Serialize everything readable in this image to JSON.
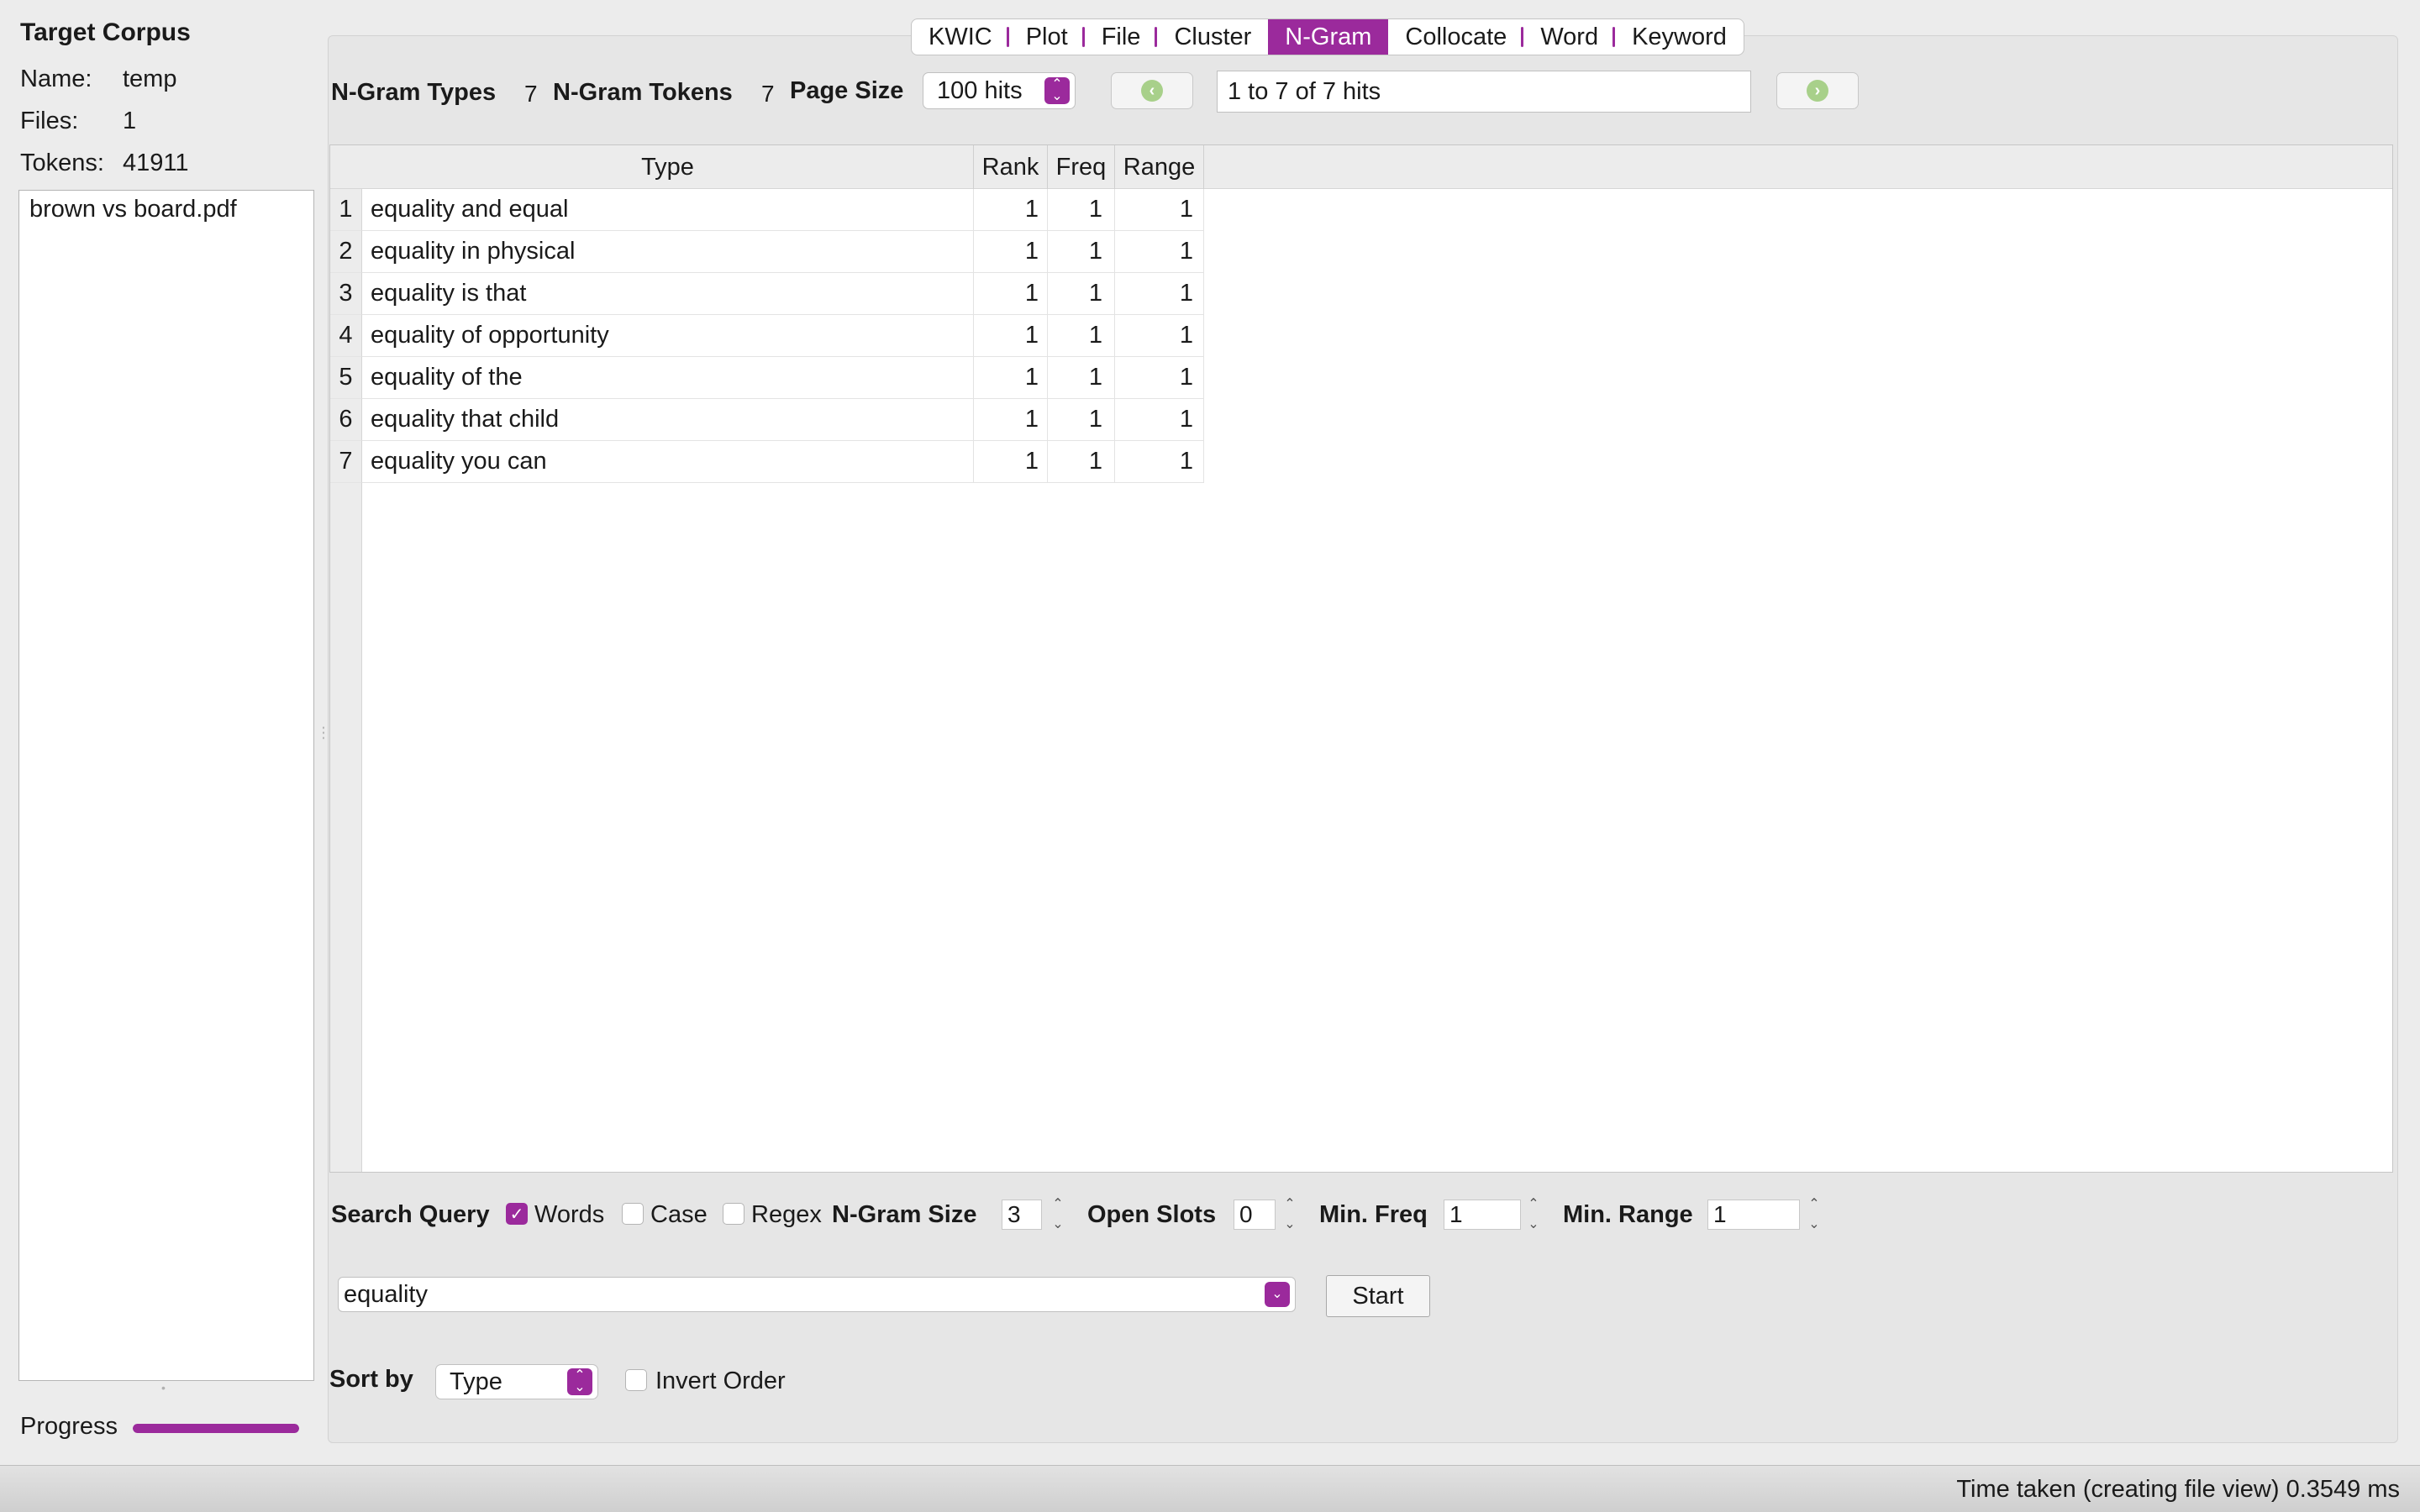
{
  "sidebar": {
    "title": "Target Corpus",
    "name_label": "Name:",
    "name_value": "temp",
    "files_label": "Files:",
    "files_value": "1",
    "tokens_label": "Tokens:",
    "tokens_value": "41911",
    "files": [
      "brown vs board.pdf"
    ],
    "progress_label": "Progress",
    "progress": 1.0
  },
  "tabs": {
    "items": [
      "KWIC",
      "Plot",
      "File",
      "Cluster",
      "N-Gram",
      "Collocate",
      "Word",
      "Keyword"
    ],
    "active": "N-Gram"
  },
  "toolbar": {
    "ngram_types_label": "N-Gram Types",
    "ngram_types_value": "7",
    "ngram_tokens_label": "N-Gram Tokens",
    "ngram_tokens_value": "7",
    "page_size_label": "Page Size",
    "page_size_value": "100 hits",
    "hits_text": "1 to 7 of 7 hits"
  },
  "table": {
    "columns": [
      "Type",
      "Rank",
      "Freq",
      "Range"
    ],
    "rows": [
      {
        "num": "1",
        "type": "equality and equal",
        "rank": "1",
        "freq": "1",
        "range": "1"
      },
      {
        "num": "2",
        "type": "equality in physical",
        "rank": "1",
        "freq": "1",
        "range": "1"
      },
      {
        "num": "3",
        "type": "equality is that",
        "rank": "1",
        "freq": "1",
        "range": "1"
      },
      {
        "num": "4",
        "type": "equality of opportunity",
        "rank": "1",
        "freq": "1",
        "range": "1"
      },
      {
        "num": "5",
        "type": "equality of the",
        "rank": "1",
        "freq": "1",
        "range": "1"
      },
      {
        "num": "6",
        "type": "equality that child",
        "rank": "1",
        "freq": "1",
        "range": "1"
      },
      {
        "num": "7",
        "type": "equality you can",
        "rank": "1",
        "freq": "1",
        "range": "1"
      }
    ]
  },
  "search": {
    "label": "Search Query",
    "words_label": "Words",
    "words_checked": true,
    "case_label": "Case",
    "case_checked": false,
    "regex_label": "Regex",
    "regex_checked": false,
    "ngram_size_label": "N-Gram Size",
    "ngram_size_value": "3",
    "open_slots_label": "Open Slots",
    "open_slots_value": "0",
    "min_freq_label": "Min. Freq",
    "min_freq_value": "1",
    "min_range_label": "Min. Range",
    "min_range_value": "1",
    "query_value": "equality",
    "start_label": "Start"
  },
  "sort": {
    "label": "Sort by",
    "value": "Type",
    "invert_label": "Invert Order",
    "invert_checked": false
  },
  "status": {
    "text": "Time taken (creating file view) 0.3549 ms"
  },
  "colors": {
    "accent": "#9b2a9c",
    "nav_arrow": "#a8d08a"
  }
}
